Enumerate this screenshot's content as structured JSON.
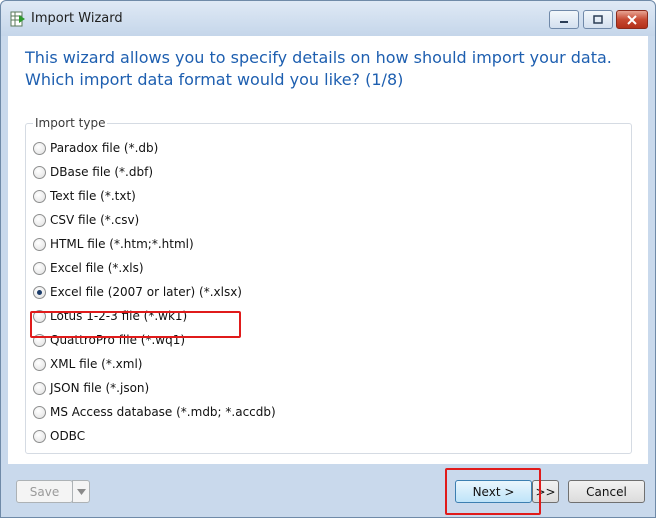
{
  "window": {
    "title": "Import Wizard",
    "accent_color": "#1e5fb0",
    "highlight_color": "#e01b1b"
  },
  "heading": {
    "line1": "This wizard allows you to specify details on how should import your data.",
    "line2": "Which import data format would you like? (1/8)"
  },
  "import_type": {
    "label": "Import type",
    "selected": "Excel file (2007 or later) (*.xlsx)",
    "options": [
      "Paradox file (*.db)",
      "DBase file (*.dbf)",
      "Text file (*.txt)",
      "CSV file (*.csv)",
      "HTML file (*.htm;*.html)",
      "Excel file (*.xls)",
      "Excel file (2007 or later) (*.xlsx)",
      "Lotus 1-2-3 file (*.wk1)",
      "QuattroPro file (*.wq1)",
      "XML file (*.xml)",
      "JSON file (*.json)",
      "MS Access database (*.mdb; *.accdb)",
      "ODBC"
    ]
  },
  "footer": {
    "save_label": "Save",
    "save_dropdown_icon": "triangle-down-icon",
    "next_label": "Next >",
    "last_label": ">>",
    "cancel_label": "Cancel"
  }
}
